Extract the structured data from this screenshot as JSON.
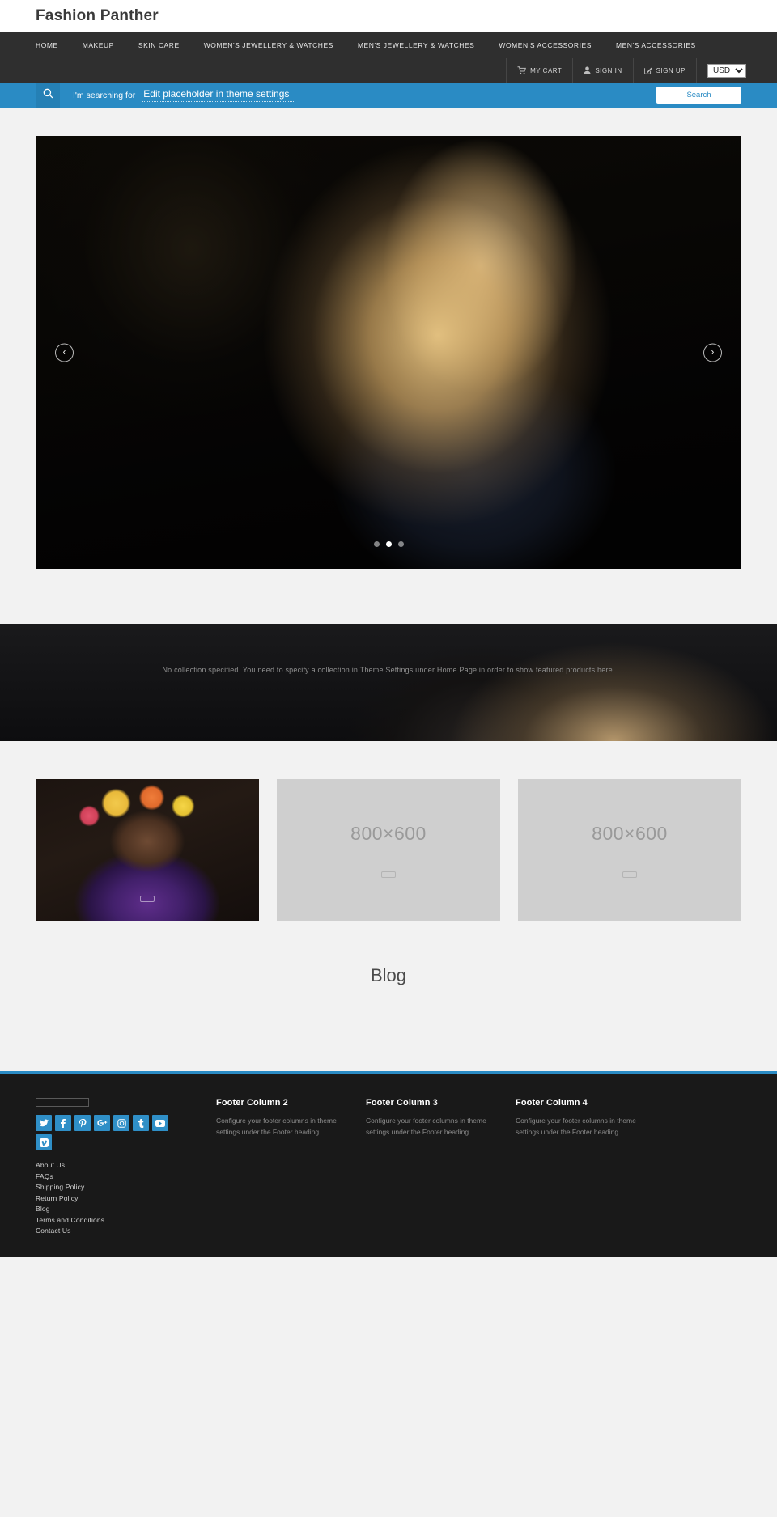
{
  "brand": {
    "name": "Fashion Panther"
  },
  "nav": {
    "items": [
      {
        "label": "HOME"
      },
      {
        "label": "MAKEUP"
      },
      {
        "label": "SKIN CARE"
      },
      {
        "label": "WOMEN'S JEWELLERY & WATCHES"
      },
      {
        "label": "MEN'S JEWELLERY & WATCHES"
      },
      {
        "label": "WOMEN'S ACCESSORIES"
      },
      {
        "label": "MEN'S ACCESSORIES"
      }
    ]
  },
  "utility": {
    "cart_label": "MY CART",
    "signin_label": "SIGN IN",
    "signup_label": "SIGN UP",
    "currency_selected": "USD",
    "currency_options": [
      "USD"
    ]
  },
  "search": {
    "label": "I'm searching for",
    "placeholder": "Edit placeholder in theme settings",
    "value": "",
    "button_label": "Search"
  },
  "hero": {
    "prev_glyph": "‹",
    "next_glyph": "›",
    "slide_count": 3,
    "active_slide": 2
  },
  "featured": {
    "message": "No collection specified. You need to specify a collection in Theme Settings under Home Page in order to show featured products here."
  },
  "tiles": [
    {
      "type": "photo",
      "placeholder_text": ""
    },
    {
      "type": "placeholder",
      "placeholder_text": "800×600"
    },
    {
      "type": "placeholder",
      "placeholder_text": "800×600"
    }
  ],
  "blog": {
    "title": "Blog"
  },
  "footer": {
    "social": [
      {
        "name": "twitter"
      },
      {
        "name": "facebook"
      },
      {
        "name": "pinterest"
      },
      {
        "name": "google-plus"
      },
      {
        "name": "instagram"
      },
      {
        "name": "tumblr"
      },
      {
        "name": "youtube"
      },
      {
        "name": "vimeo"
      }
    ],
    "links": [
      {
        "label": "About Us"
      },
      {
        "label": "FAQs"
      },
      {
        "label": "Shipping Policy"
      },
      {
        "label": "Return Policy"
      },
      {
        "label": "Blog"
      },
      {
        "label": "Terms and Conditions"
      },
      {
        "label": "Contact Us"
      }
    ],
    "columns": [
      {
        "heading": "Footer Column 2",
        "body": "Configure your footer columns in theme settings under the Footer heading."
      },
      {
        "heading": "Footer Column 3",
        "body": "Configure your footer columns in theme settings under the Footer heading."
      },
      {
        "heading": "Footer Column 4",
        "body": "Configure your footer columns in theme settings under the Footer heading."
      }
    ]
  },
  "colors": {
    "accent": "#2a8bc4",
    "nav_bg": "#2f2f2f",
    "footer_bg": "#191919",
    "page_bg": "#f2f2f2"
  }
}
